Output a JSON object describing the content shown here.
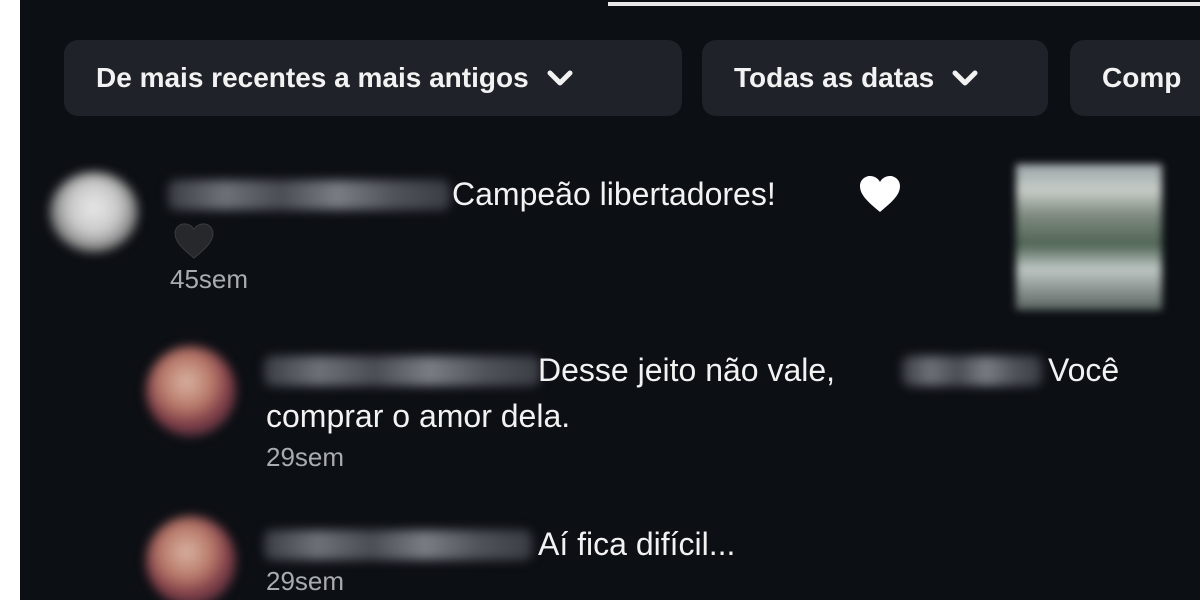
{
  "filters": {
    "sort_label": "De mais recentes a mais antigos",
    "date_label": "Todas as datas",
    "more_label": "Comp"
  },
  "comments": [
    {
      "text": "Campeão libertadores!",
      "time": "45sem",
      "icons": [
        "white-heart-icon",
        "black-heart-icon"
      ]
    },
    {
      "text_part1": "Desse jeito não vale,",
      "text_part2": "Você",
      "text_line2": "comprar o amor dela.",
      "time": "29sem"
    },
    {
      "text": "Aí fica difícil...",
      "time": "29sem"
    }
  ],
  "colors": {
    "background": "#0c0f14",
    "chip": "#1f2228",
    "text": "#f2f2f2",
    "muted": "#a8abb0"
  }
}
